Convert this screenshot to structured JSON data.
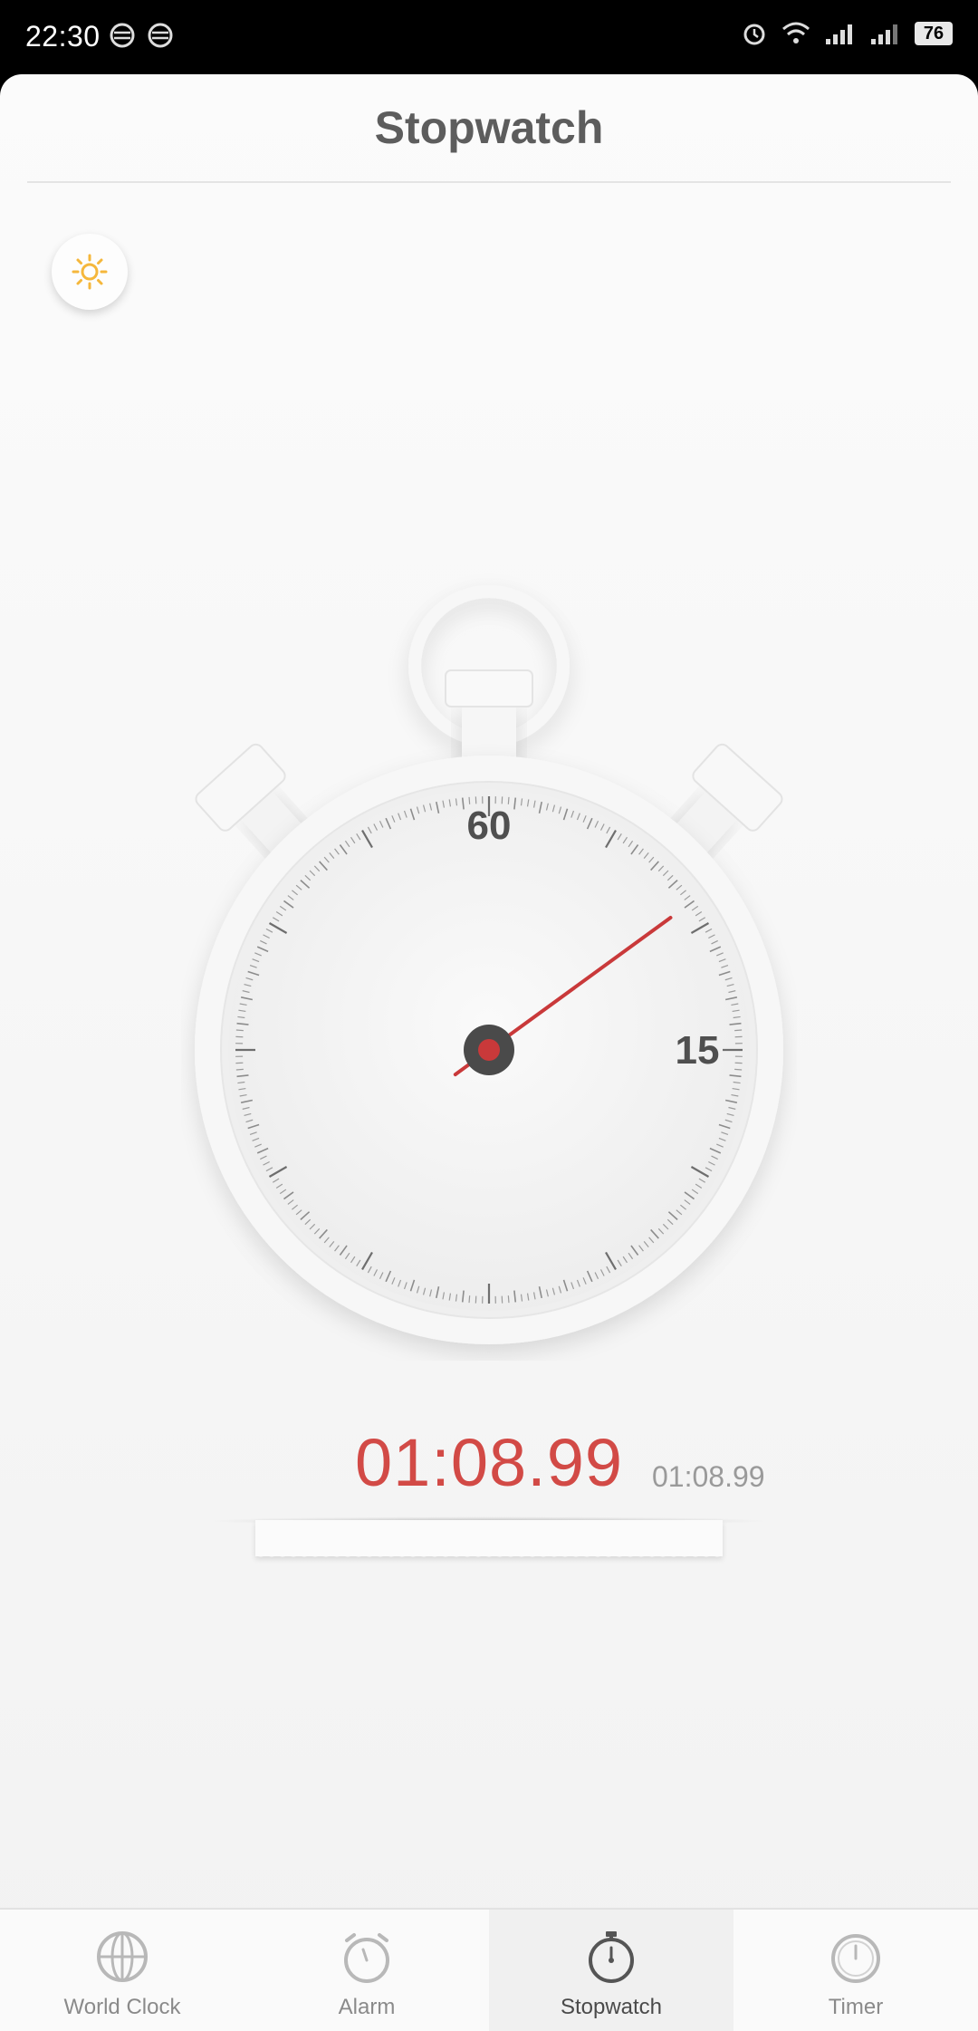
{
  "status_bar": {
    "time": "22:30",
    "battery": "76",
    "icons": [
      "network-icon",
      "network-icon",
      "alarm-icon",
      "wifi-icon",
      "signal-icon",
      "signal-icon",
      "battery-icon"
    ]
  },
  "header": {
    "title": "Stopwatch"
  },
  "brightness_button": {
    "icon": "sun-icon",
    "color": "#f5b73b"
  },
  "dial": {
    "label_top": "60",
    "label_right": "15",
    "hand_color": "#c9393a",
    "elapsed_seconds": 8.99
  },
  "readout": {
    "main": "01:08.99",
    "lap": "01:08.99",
    "main_color": "#d24a46"
  },
  "bottom_nav": {
    "items": [
      {
        "label": "World Clock",
        "icon": "globe-icon",
        "active": false
      },
      {
        "label": "Alarm",
        "icon": "alarm-clock-icon",
        "active": false
      },
      {
        "label": "Stopwatch",
        "icon": "stopwatch-icon",
        "active": true
      },
      {
        "label": "Timer",
        "icon": "timer-icon",
        "active": false
      }
    ]
  }
}
